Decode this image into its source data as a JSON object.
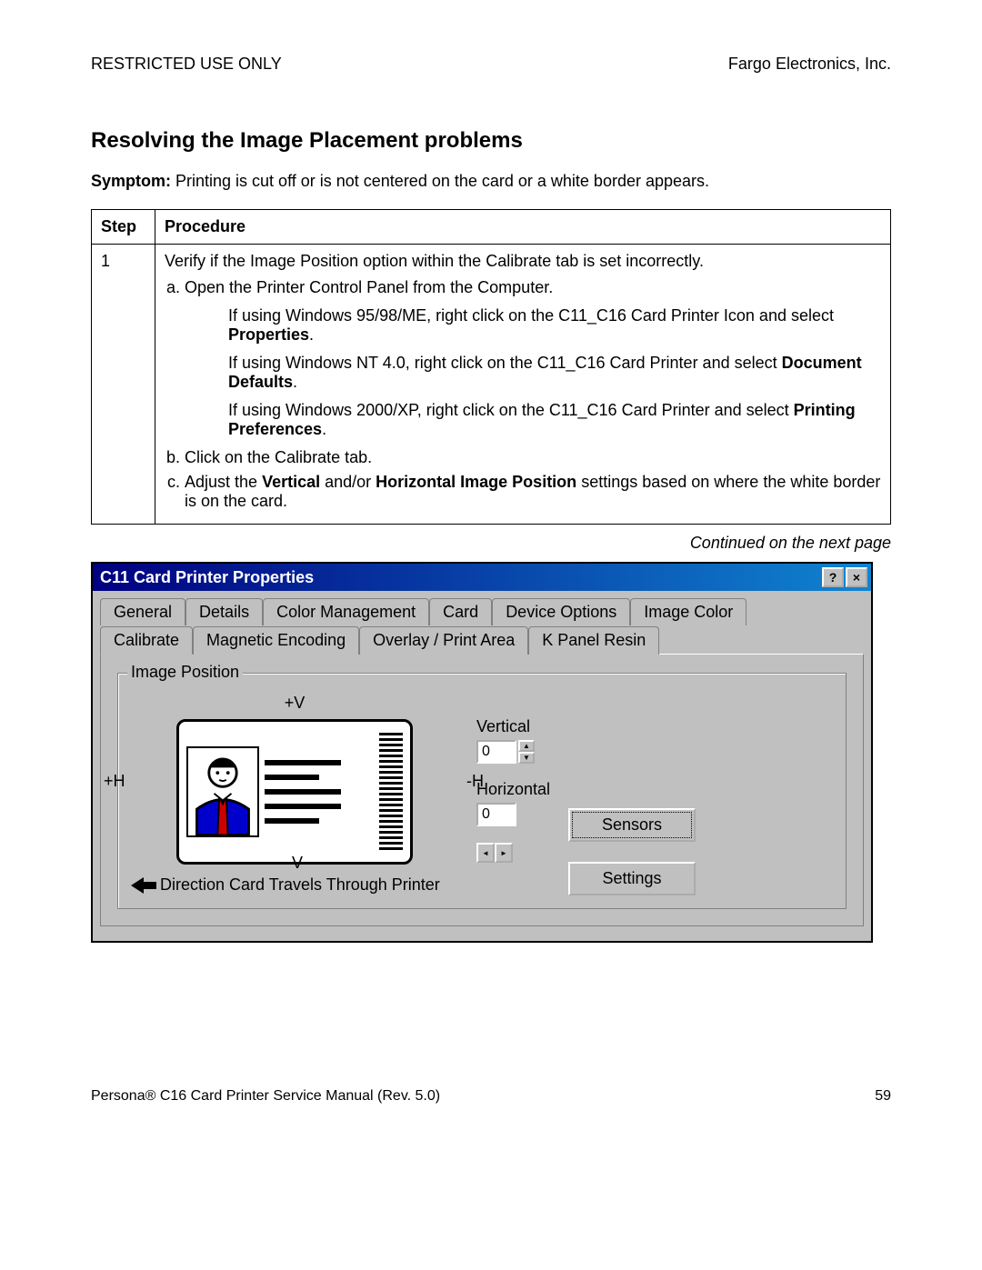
{
  "header": {
    "left": "RESTRICTED USE ONLY",
    "right": "Fargo Electronics, Inc."
  },
  "title": "Resolving the Image Placement problems",
  "symptom": {
    "label": "Symptom:",
    "text": "  Printing is cut off or is not centered on the card or a white border appears."
  },
  "table": {
    "head_step": "Step",
    "head_proc": "Procedure",
    "step_num": "1",
    "row_main": "Verify if the Image Position option within the Calibrate tab is set incorrectly.",
    "a": "Open the Printer Control Panel from the Computer.",
    "a_sub1_pre": "If using Windows 95/98/ME, right click on the C11_C16 Card Printer Icon and select ",
    "a_sub1_bold": "Properties",
    "a_sub2_pre": "If using Windows NT 4.0, right click on the C11_C16 Card Printer and select ",
    "a_sub2_bold": "Document Defaults",
    "a_sub3_pre": "If using Windows 2000/XP, right click on the C11_C16 Card Printer and select ",
    "a_sub3_bold": "Printing Preferences",
    "b": "Click on the Calibrate tab.",
    "c_pre": "Adjust the ",
    "c_b1": "Vertical",
    "c_mid": " and/or ",
    "c_b2": "Horizontal Image Position",
    "c_post": " settings based on where the white border is on the card."
  },
  "continued": "Continued on the next page",
  "win": {
    "title": "C11 Card Printer Properties",
    "help_btn": "?",
    "close_btn": "×",
    "tabs_back": [
      "General",
      "Details",
      "Color Management",
      "Card",
      "Device Options",
      "Image Color"
    ],
    "tabs_front": [
      "Calibrate",
      "Magnetic Encoding",
      "Overlay / Print Area",
      "K Panel Resin"
    ],
    "active_tab": "Calibrate",
    "group_title": "Image Position",
    "plusV": "+V",
    "minusV": "-V",
    "plusH": "+H",
    "minusH": "-H",
    "direction": "Direction Card Travels Through Printer",
    "vertical_label": "Vertical",
    "vertical_value": "0",
    "horizontal_label": "Horizontal",
    "horizontal_value": "0",
    "sensors_btn": "Sensors",
    "settings_btn": "Settings",
    "up": "▲",
    "down": "▼",
    "left": "◄",
    "right": "►"
  },
  "footer": {
    "left": "Persona® C16 Card Printer Service Manual (Rev. 5.0)",
    "right": "59"
  }
}
